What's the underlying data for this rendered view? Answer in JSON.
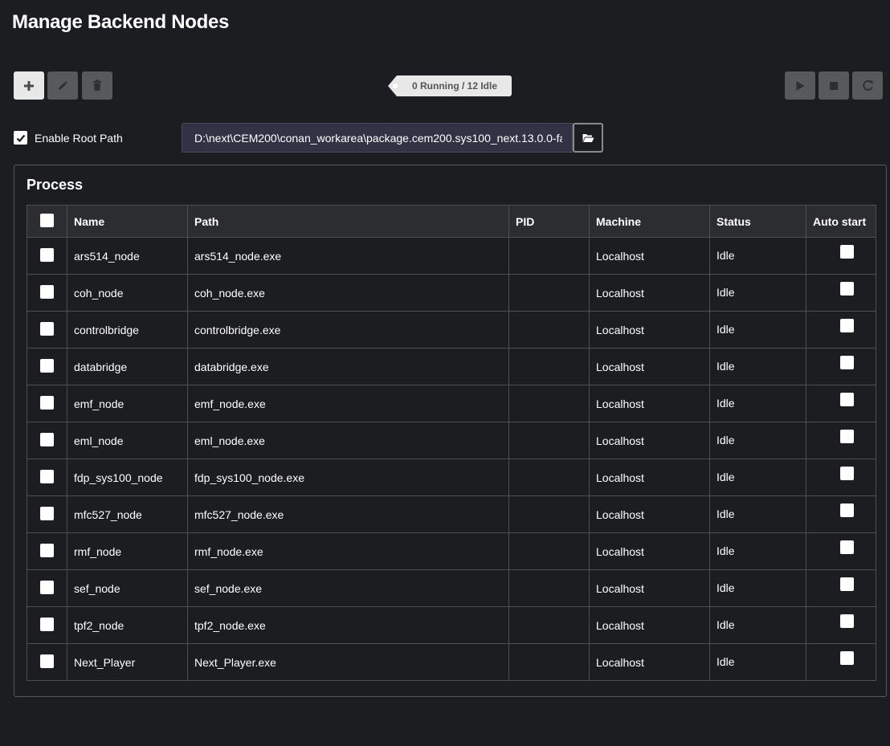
{
  "page": {
    "title": "Manage Backend Nodes"
  },
  "toolbar": {
    "add_icon": "plus-icon",
    "edit_icon": "pencil-icon",
    "delete_icon": "trash-icon",
    "play_icon": "play-icon",
    "stop_icon": "stop-icon",
    "restart_icon": "refresh-icon"
  },
  "status_summary": {
    "text": "0 Running / 12 Idle"
  },
  "root_path": {
    "enabled": true,
    "label": "Enable Root Path",
    "value": "D:\\next\\CEM200\\conan_workarea\\package.cem200.sys100_next.13.0.0-fa",
    "browse_icon": "folder-open-icon"
  },
  "process": {
    "title": "Process",
    "columns": {
      "name": "Name",
      "path": "Path",
      "pid": "PID",
      "machine": "Machine",
      "status": "Status",
      "auto_start": "Auto start"
    },
    "rows": [
      {
        "name": "ars514_node",
        "path": "ars514_node.exe",
        "pid": "",
        "machine": "Localhost",
        "status": "Idle",
        "selected": false,
        "auto_start": false
      },
      {
        "name": "coh_node",
        "path": "coh_node.exe",
        "pid": "",
        "machine": "Localhost",
        "status": "Idle",
        "selected": false,
        "auto_start": false
      },
      {
        "name": "controlbridge",
        "path": "controlbridge.exe",
        "pid": "",
        "machine": "Localhost",
        "status": "Idle",
        "selected": false,
        "auto_start": false
      },
      {
        "name": "databridge",
        "path": "databridge.exe",
        "pid": "",
        "machine": "Localhost",
        "status": "Idle",
        "selected": false,
        "auto_start": false
      },
      {
        "name": "emf_node",
        "path": "emf_node.exe",
        "pid": "",
        "machine": "Localhost",
        "status": "Idle",
        "selected": false,
        "auto_start": false
      },
      {
        "name": "eml_node",
        "path": "eml_node.exe",
        "pid": "",
        "machine": "Localhost",
        "status": "Idle",
        "selected": false,
        "auto_start": false
      },
      {
        "name": "fdp_sys100_node",
        "path": "fdp_sys100_node.exe",
        "pid": "",
        "machine": "Localhost",
        "status": "Idle",
        "selected": false,
        "auto_start": false
      },
      {
        "name": "mfc527_node",
        "path": "mfc527_node.exe",
        "pid": "",
        "machine": "Localhost",
        "status": "Idle",
        "selected": false,
        "auto_start": false
      },
      {
        "name": "rmf_node",
        "path": "rmf_node.exe",
        "pid": "",
        "machine": "Localhost",
        "status": "Idle",
        "selected": false,
        "auto_start": false
      },
      {
        "name": "sef_node",
        "path": "sef_node.exe",
        "pid": "",
        "machine": "Localhost",
        "status": "Idle",
        "selected": false,
        "auto_start": false
      },
      {
        "name": "tpf2_node",
        "path": "tpf2_node.exe",
        "pid": "",
        "machine": "Localhost",
        "status": "Idle",
        "selected": false,
        "auto_start": false
      },
      {
        "name": "Next_Player",
        "path": "Next_Player.exe",
        "pid": "",
        "machine": "Localhost",
        "status": "Idle",
        "selected": false,
        "auto_start": false
      }
    ]
  }
}
